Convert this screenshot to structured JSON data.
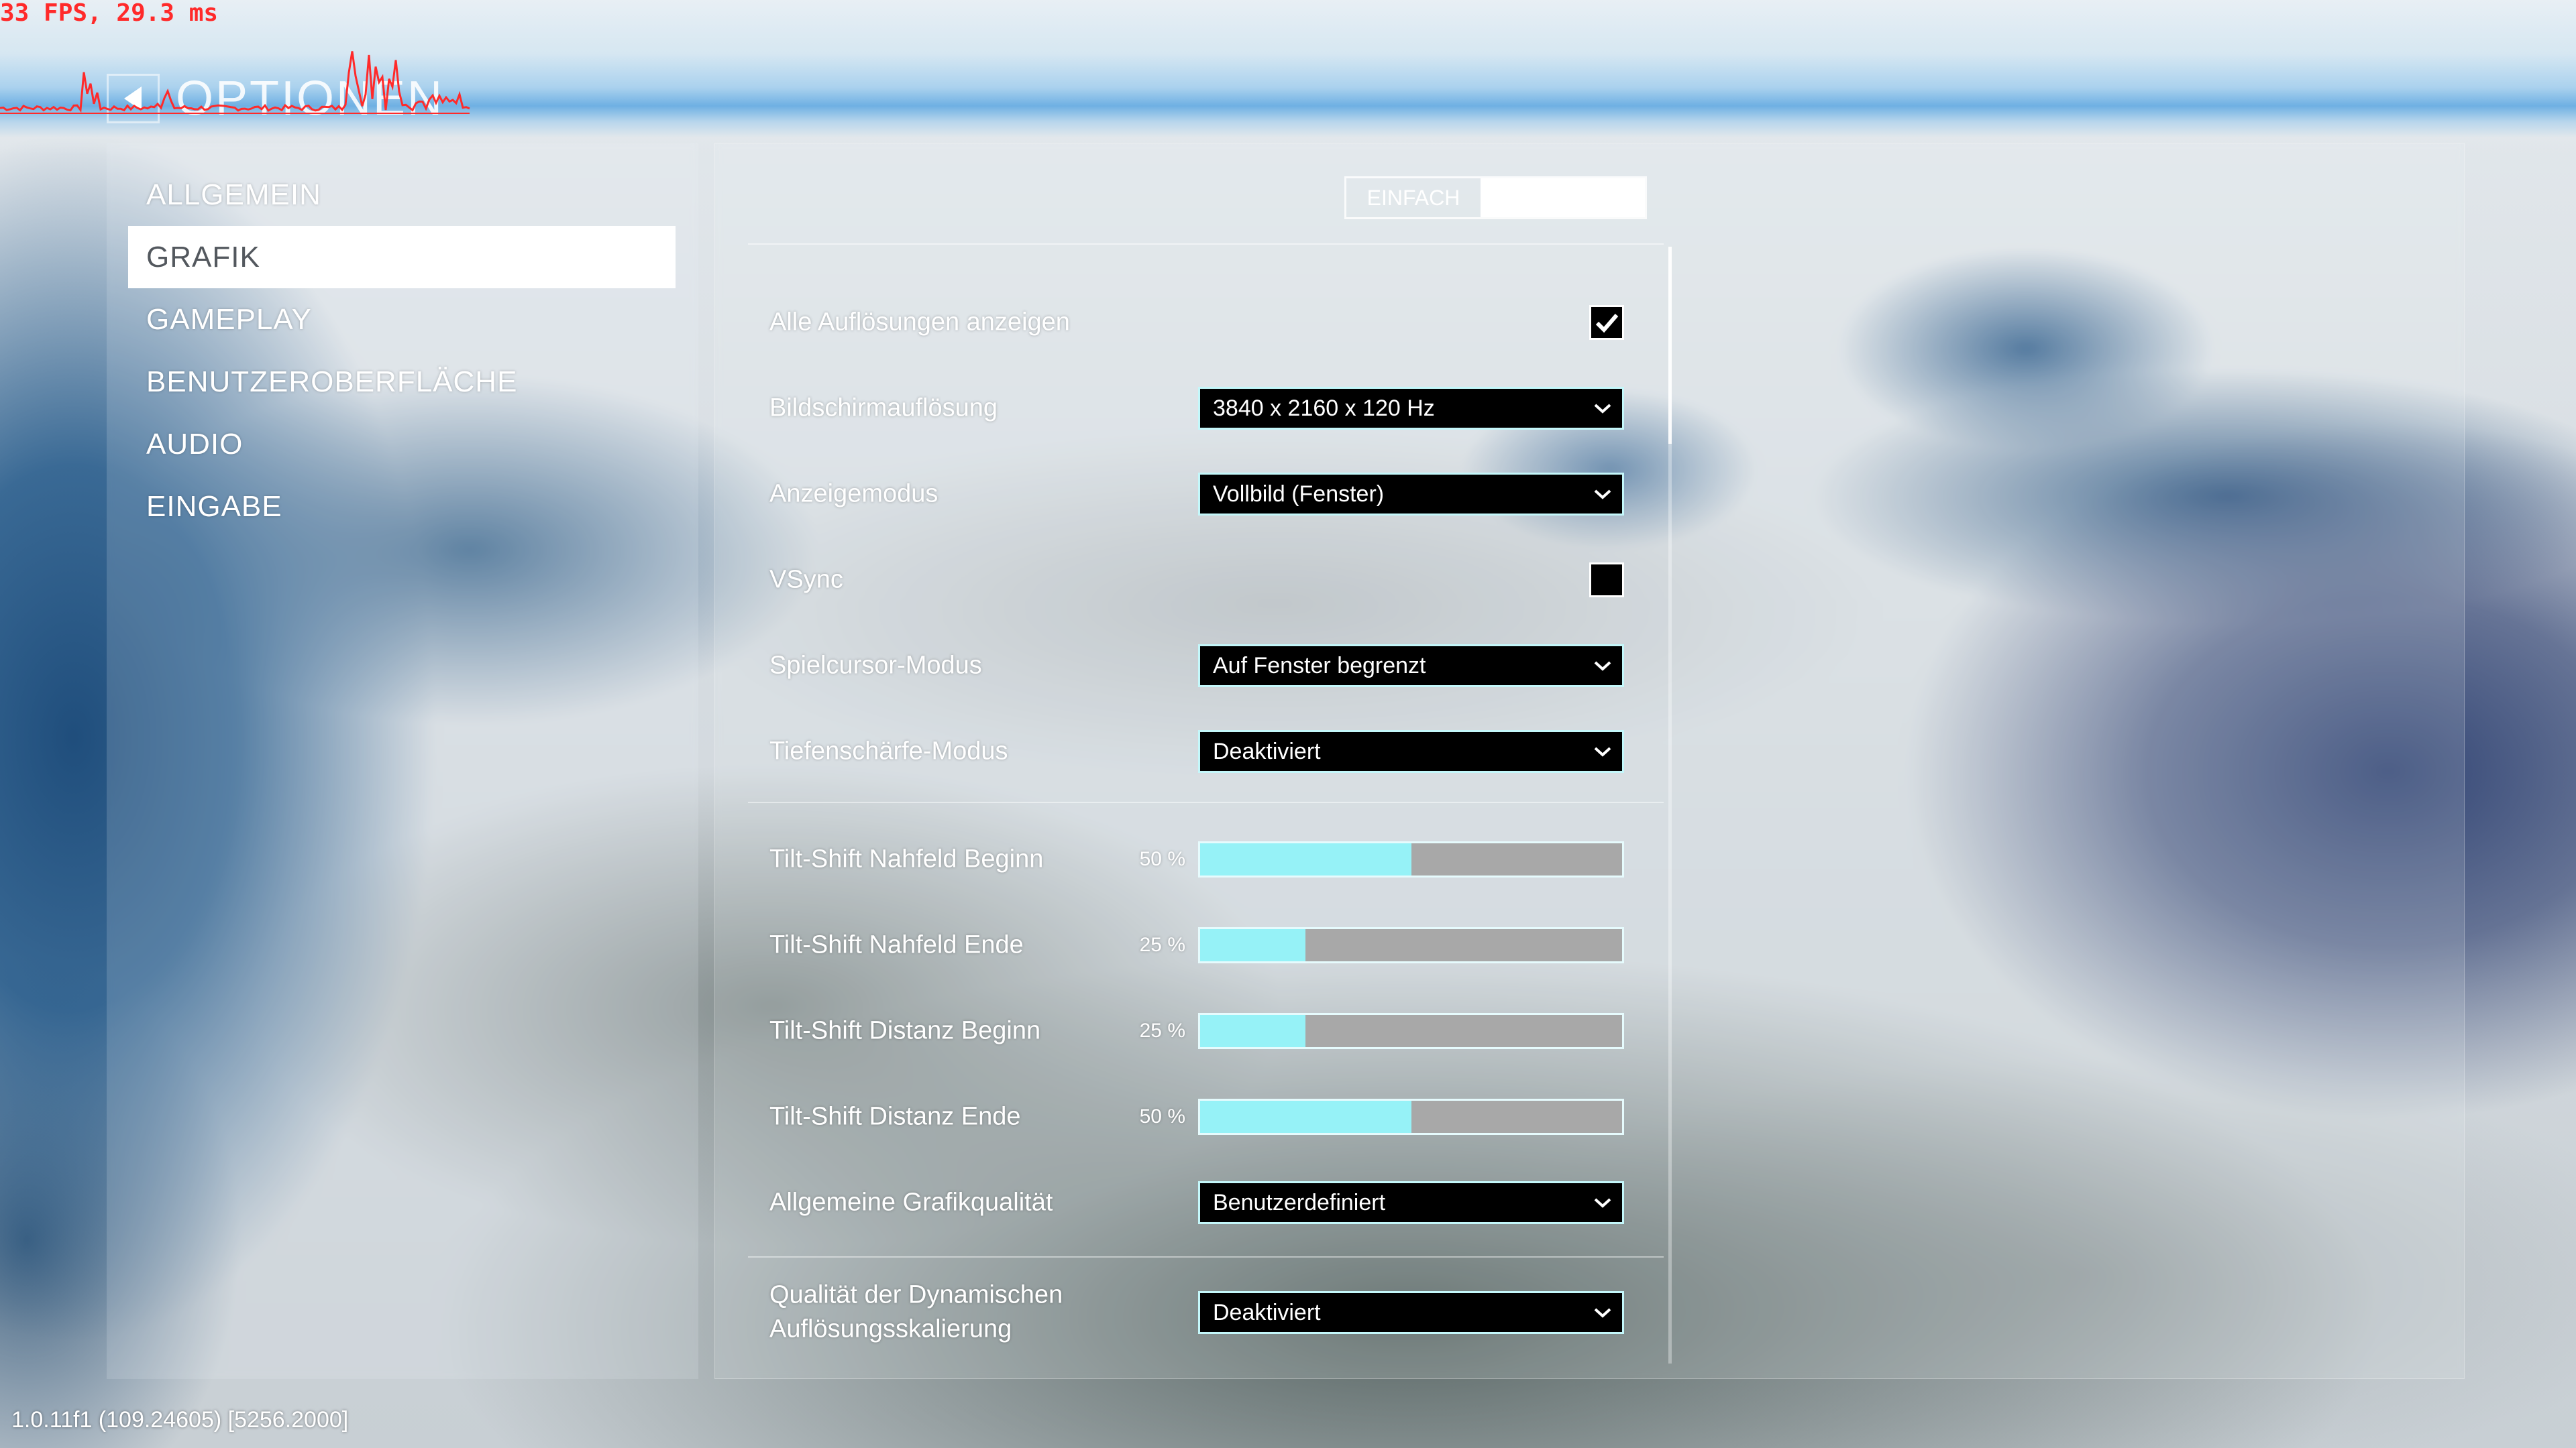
{
  "debug": {
    "fps_text": "33 FPS, 29.3 ms"
  },
  "header": {
    "title": "OPTIONEN",
    "back_icon": "back-arrow-icon"
  },
  "sidebar": {
    "items": [
      {
        "label": "ALLGEMEIN",
        "selected": false
      },
      {
        "label": "GRAFIK",
        "selected": true
      },
      {
        "label": "GAMEPLAY",
        "selected": false
      },
      {
        "label": "BENUTZEROBERFLÄCHE",
        "selected": false
      },
      {
        "label": "AUDIO",
        "selected": false
      },
      {
        "label": "EINGABE",
        "selected": false
      }
    ]
  },
  "mode_toggle": {
    "left_label": "EINFACH",
    "selected_segment": 1
  },
  "settings": [
    {
      "label": "Alle Auflösungen anzeigen",
      "type": "checkbox",
      "checked": true
    },
    {
      "label": "Bildschirmauflösung",
      "type": "dropdown",
      "value": "3840 x 2160 x 120 Hz"
    },
    {
      "label": "Anzeigemodus",
      "type": "dropdown",
      "value": "Vollbild (Fenster)"
    },
    {
      "label": "VSync",
      "type": "checkbox",
      "checked": false
    },
    {
      "label": "Spielcursor-Modus",
      "type": "dropdown",
      "value": "Auf Fenster begrenzt"
    },
    {
      "label": "Tiefenschärfe-Modus",
      "type": "dropdown",
      "value": "Deaktiviert"
    },
    {
      "label": "Tilt-Shift Nahfeld Beginn",
      "type": "slider",
      "value": 50,
      "value_text": "50 %"
    },
    {
      "label": "Tilt-Shift Nahfeld Ende",
      "type": "slider",
      "value": 25,
      "value_text": "25 %"
    },
    {
      "label": "Tilt-Shift Distanz Beginn",
      "type": "slider",
      "value": 25,
      "value_text": "25 %"
    },
    {
      "label": "Tilt-Shift Distanz Ende",
      "type": "slider",
      "value": 50,
      "value_text": "50 %"
    },
    {
      "label": "Allgemeine Grafikqualität",
      "type": "dropdown",
      "value": "Benutzerdefiniert"
    },
    {
      "label": "Qualität der Dynamischen Auflösungsskalierung",
      "type": "dropdown",
      "value": "Deaktiviert"
    }
  ],
  "version": "1.0.11f1 (109.24605) [5256.2000]",
  "icons": {
    "back": "back-arrow-icon",
    "dropdown": "chevron-down-icon",
    "checkbox": "checkmark-icon"
  },
  "colors": {
    "accent": "#96f2f7",
    "accent_border": "#c4f7fa",
    "fps_text": "#ff2a2a",
    "selected_item_bg": "#ffffff",
    "selected_item_text": "#53585e",
    "slider_track": "#a8a8a8",
    "control_bg": "#000000"
  }
}
